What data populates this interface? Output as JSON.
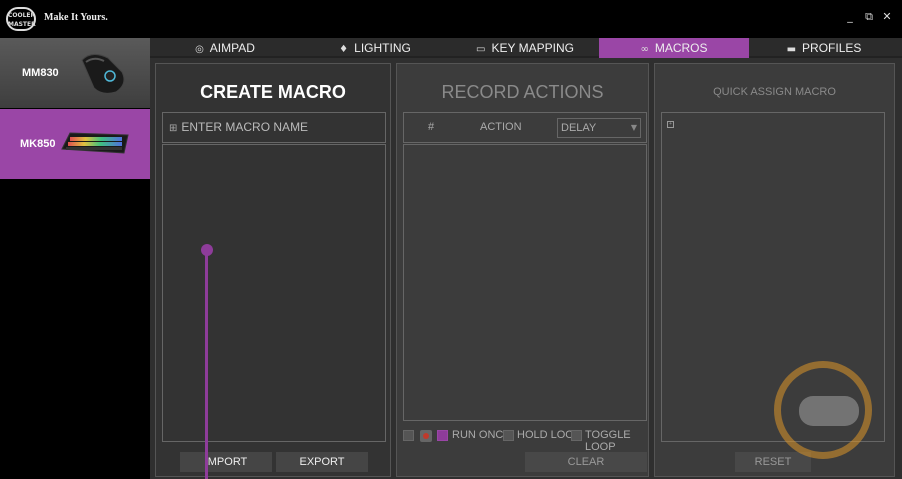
{
  "app": {
    "brand_lines": [
      "COOLER",
      "MASTER"
    ],
    "tagline": "Make It Yours."
  },
  "window_controls": {
    "minimize": "_",
    "maximize": "⧉",
    "close": "✕"
  },
  "devices": [
    {
      "label": "MM830",
      "icon": "mouse-icon"
    },
    {
      "label": "MK850",
      "icon": "keyboard-icon"
    }
  ],
  "tabs": [
    {
      "label": "AIMPAD",
      "icon": "aimpad-icon",
      "glyph": "◎"
    },
    {
      "label": "LIGHTING",
      "icon": "bulb-icon",
      "glyph": "♦"
    },
    {
      "label": "KEY MAPPING",
      "icon": "keyboard-key-icon",
      "glyph": "▭"
    },
    {
      "label": "MACROS",
      "icon": "macro-icon",
      "glyph": "∞"
    },
    {
      "label": "PROFILES",
      "icon": "profile-icon",
      "glyph": "▬"
    }
  ],
  "active_tab": "MACROS",
  "create_macro": {
    "title": "CREATE MACRO",
    "name_placeholder": "ENTER MACRO NAME",
    "import_label": "IMPORT",
    "export_label": "EXPORT"
  },
  "record_actions": {
    "title": "RECORD ACTIONS",
    "col_number": "#",
    "col_action": "ACTION",
    "delay_value": "DELAY",
    "run_once": "RUN ONCE",
    "hold_loop": "HOLD LOOP",
    "toggle_loop": "TOGGLE LOOP",
    "clear_label": "CLEAR"
  },
  "quick_assign": {
    "title": "QUICK ASSIGN MACRO",
    "reset_label": "RESET"
  },
  "colors": {
    "accent": "#9a46a6",
    "panel": "#3c3c3c",
    "record": "#c0392b"
  }
}
